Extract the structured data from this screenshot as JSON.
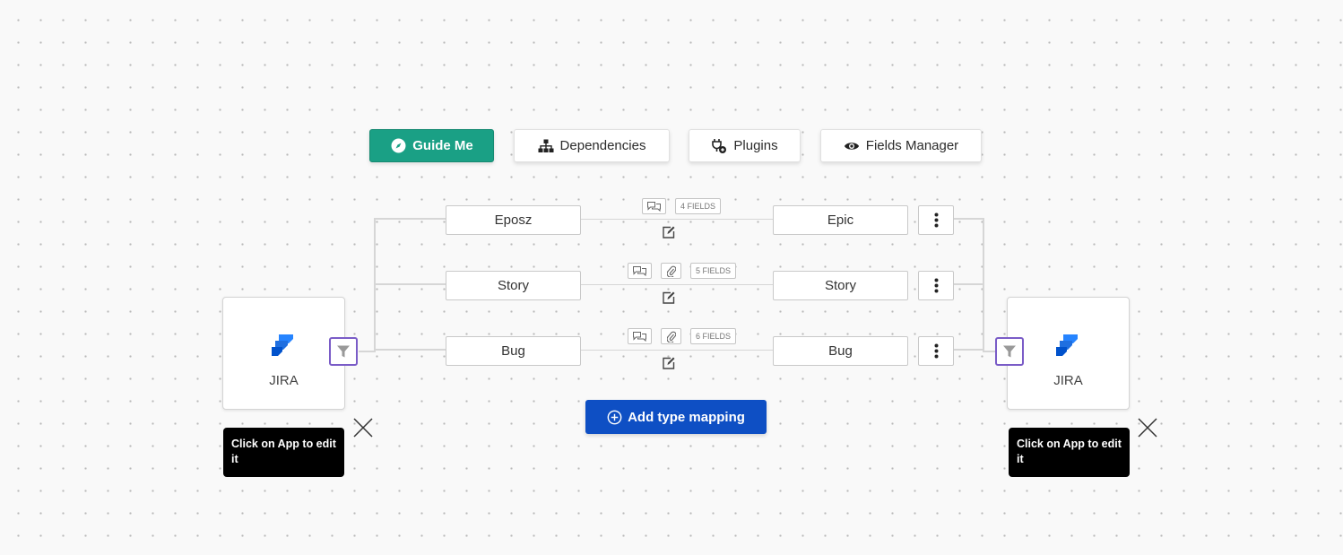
{
  "toolbar": {
    "guide_me": "Guide Me",
    "dependencies": "Dependencies",
    "plugins": "Plugins",
    "fields_manager": "Fields Manager"
  },
  "left_app": {
    "name": "JIRA",
    "tooltip": "Click on App to edit it"
  },
  "right_app": {
    "name": "JIRA",
    "tooltip": "Click on App to edit it"
  },
  "mappings": [
    {
      "source": "Eposz",
      "target": "Epic",
      "fields": "4 FIELDS",
      "has_attachment": false
    },
    {
      "source": "Story",
      "target": "Story",
      "fields": "5 FIELDS",
      "has_attachment": true
    },
    {
      "source": "Bug",
      "target": "Bug",
      "fields": "6 FIELDS",
      "has_attachment": true
    }
  ],
  "add_button": {
    "label": "Add type mapping"
  },
  "colors": {
    "primary_green": "#1aa085",
    "primary_blue": "#0e4fc4",
    "filter_purple": "#7a5cc7",
    "jira_blue": "#2684ff"
  },
  "icons": {
    "guide_me": "compass-icon",
    "dependencies": "sitemap-icon",
    "plugins": "plug-icon",
    "fields_manager": "eye-icon",
    "comment": "comment-icon",
    "attachment": "paperclip-icon",
    "edit": "edit-icon",
    "more": "kebab-menu-icon",
    "filter": "filter-icon",
    "close": "close-icon",
    "add": "plus-circle-icon",
    "app": "jira-logo-icon"
  }
}
